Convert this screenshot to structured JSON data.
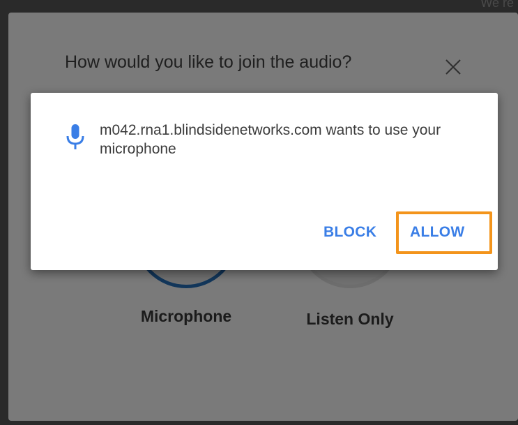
{
  "corner_text": "We re",
  "dialog": {
    "title": "How would you like to join the audio?",
    "close_icon": "close-icon",
    "options": [
      {
        "label": "Microphone",
        "icon": "microphone-option-circle"
      },
      {
        "label": "Listen Only",
        "icon": "listen-only-option-circle"
      }
    ]
  },
  "permission_prompt": {
    "icon": "microphone-icon",
    "message": "m042.rna1.blindsidenetworks.com wants to use your microphone",
    "block_label": "BLOCK",
    "allow_label": "ALLOW"
  },
  "colors": {
    "overlay": "#7a7a7a",
    "button_text": "#3a7ee6",
    "highlight": "#f3941b",
    "mic_ring": "#12365a"
  }
}
